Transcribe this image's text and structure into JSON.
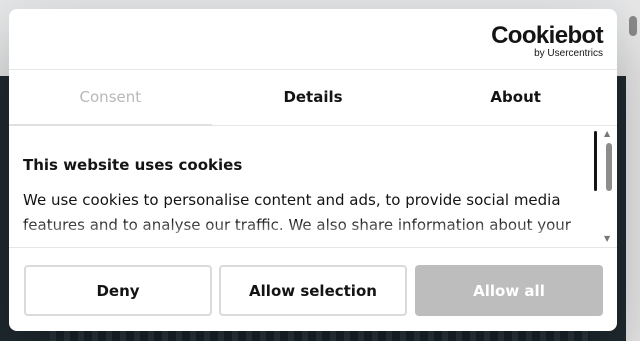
{
  "brand": {
    "logo_text": "Cookiebot",
    "logo_subtext": "by Usercentrics"
  },
  "tabs": [
    {
      "label": "Consent",
      "active": true
    },
    {
      "label": "Details",
      "active": false
    },
    {
      "label": "About",
      "active": false
    }
  ],
  "consent": {
    "heading": "This website uses cookies",
    "body": "We use cookies to personalise content and ads, to provide social media features and to analyse our traffic. We also share information about your"
  },
  "buttons": {
    "deny": "Deny",
    "allow_selection": "Allow selection",
    "allow_all": "Allow all"
  },
  "colors": {
    "text": "#141414",
    "allow_all_bg": "#bdbdbd",
    "inactive_tab": "#b8b8b8"
  }
}
